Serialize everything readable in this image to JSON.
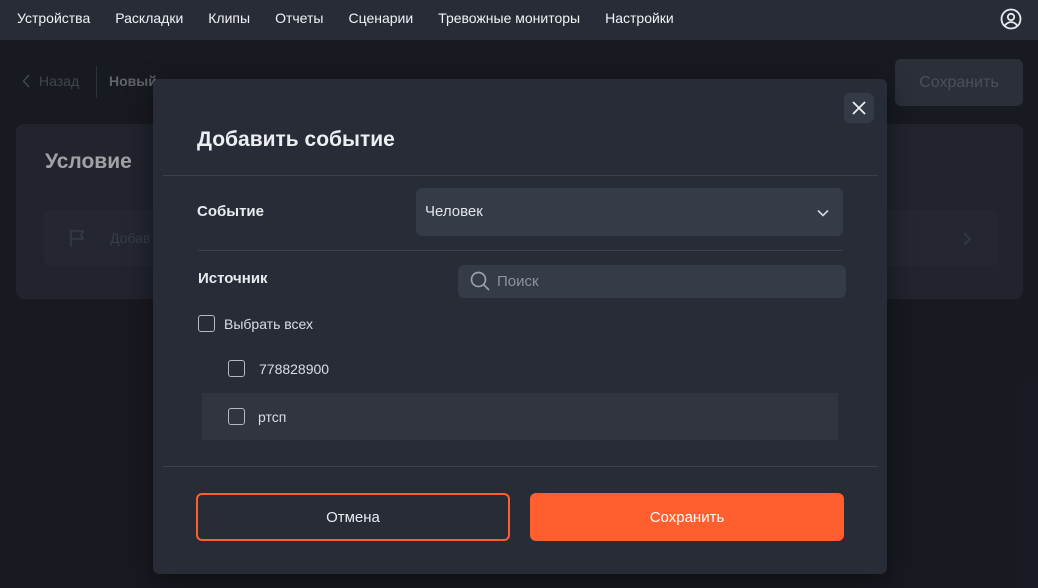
{
  "nav": {
    "items": [
      {
        "label": "Устройства"
      },
      {
        "label": "Раскладки"
      },
      {
        "label": "Клипы"
      },
      {
        "label": "Отчеты"
      },
      {
        "label": "Сценарии"
      },
      {
        "label": "Тревожные мониторы"
      },
      {
        "label": "Настройки"
      }
    ],
    "user_icon": "user-circle-icon"
  },
  "page": {
    "back_label": "Назад",
    "title_partial": "Новый",
    "save_label": "Сохранить",
    "card_title": "Условие",
    "row_partial": "Добав"
  },
  "modal": {
    "title": "Добавить событие",
    "event_label": "Событие",
    "event_value": "Человек",
    "source_label": "Источник",
    "search_placeholder": "Поиск",
    "select_all_label": "Выбрать всех",
    "sources": [
      {
        "label": "778828900"
      },
      {
        "label": "ртсп"
      }
    ],
    "cancel_label": "Отмена",
    "save_label": "Сохранить"
  },
  "colors": {
    "accent": "#ff5f2e",
    "background": "#1c2029",
    "panel": "#272c37"
  }
}
